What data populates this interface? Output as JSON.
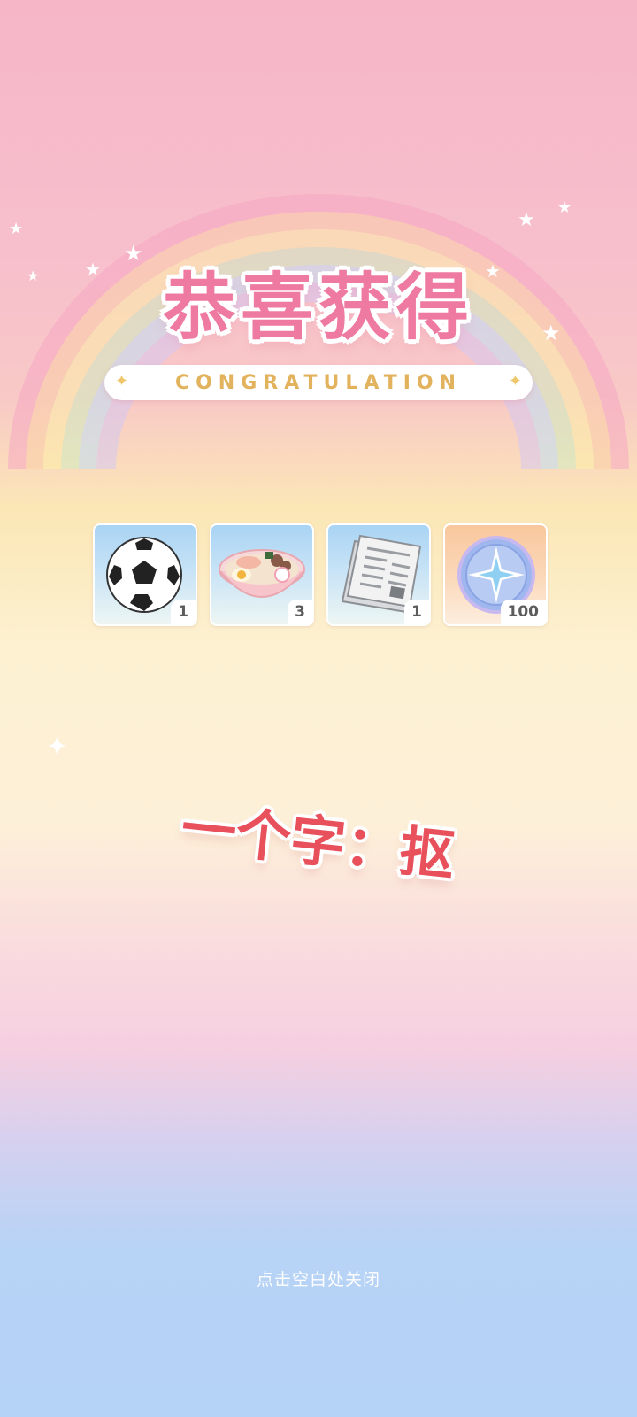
{
  "header": {
    "title": "恭喜获得",
    "subtitle": "CONGRATULATION"
  },
  "rewards": [
    {
      "icon": "soccer-ball-icon",
      "quantity": "1"
    },
    {
      "icon": "ramen-bowl-icon",
      "quantity": "3"
    },
    {
      "icon": "newspaper-icon",
      "quantity": "1"
    },
    {
      "icon": "star-coin-icon",
      "quantity": "100"
    }
  ],
  "answer": {
    "text": "一个字：抠"
  },
  "footer": {
    "close_hint": "点击空白处关闭"
  },
  "colors": {
    "title": "#ef7aa1",
    "subtitle": "#e2b25c",
    "answer": "#e8505b"
  }
}
